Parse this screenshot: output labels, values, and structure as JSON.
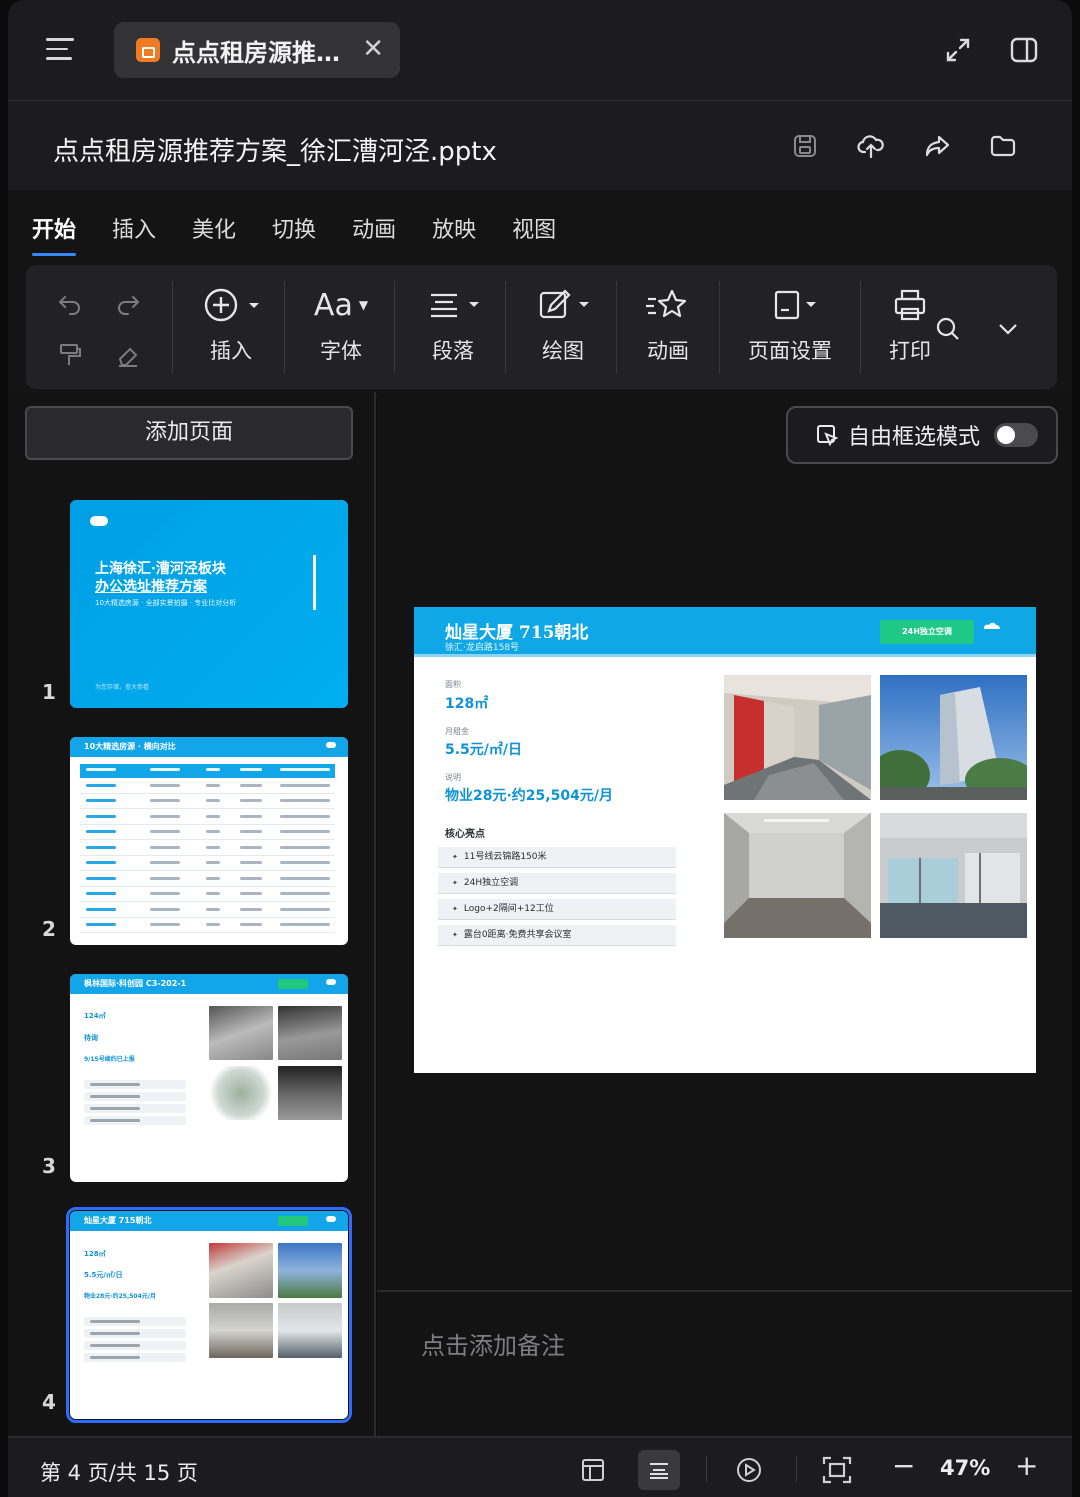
{
  "tab": {
    "title": "点点租房源推…",
    "close": "✕"
  },
  "file": {
    "name": "点点租房源推荐方案_徐汇漕河泾.pptx"
  },
  "menu_tabs": [
    "开始",
    "插入",
    "美化",
    "切换",
    "动画",
    "放映",
    "视图"
  ],
  "toolbar": {
    "insert": "插入",
    "font": "字体",
    "paragraph": "段落",
    "draw": "绘图",
    "animation": "动画",
    "page_setup": "页面设置",
    "print": "打印",
    "font_glyph": "Aa"
  },
  "sidebar": {
    "add_page": "添加页面",
    "thumbs": [
      {
        "num": "1",
        "title_line1": "上海徐汇·漕河泾板块",
        "title_line2": "办公选址推荐方案",
        "subtitle": "10大精选房源 · 全部实景拍摄 · 专业比对分析",
        "footer": "为您存储，查大参看"
      },
      {
        "num": "2",
        "title": "10大精选房源 · 横向对比"
      },
      {
        "num": "3",
        "title": "枫林国际·科创园 C3-202-1",
        "area": "124㎡",
        "rent": "待询",
        "price": "9/15号续约已上报"
      },
      {
        "num": "4",
        "title": "灿星大厦 715朝北",
        "area": "128㎡",
        "rent": "5.5元/㎡/日",
        "price": "物业28元·约25,504元/月"
      }
    ]
  },
  "main": {
    "free_select": "自由框选模式",
    "free_select_on": false,
    "slide": {
      "title": "灿星大厦 715朝北",
      "subtitle": "徐汇·龙启路158号",
      "badge": "24H独立空调",
      "area_label": "面积",
      "area_value": "128㎡",
      "rent_label": "月租金",
      "rent_value": "5.5元/㎡/日",
      "note_label": "说明",
      "note_value": "物业28元·约25,504元/月",
      "core_label": "核心亮点",
      "bullets": [
        "11号线云锦路150米",
        "24H独立空调",
        "Logo+2隔间+12工位",
        "露台0距离·免费共享会议室"
      ]
    },
    "notes_placeholder": "点击添加备注"
  },
  "status": {
    "page_info": "第 4 页/共 15 页",
    "zoom": "47%",
    "zoom_minus": "−",
    "zoom_plus": "+"
  },
  "colors": {
    "accent": "#2f6bff",
    "slide_blue": "#0fa7e6",
    "badge_green": "#1fc985"
  }
}
